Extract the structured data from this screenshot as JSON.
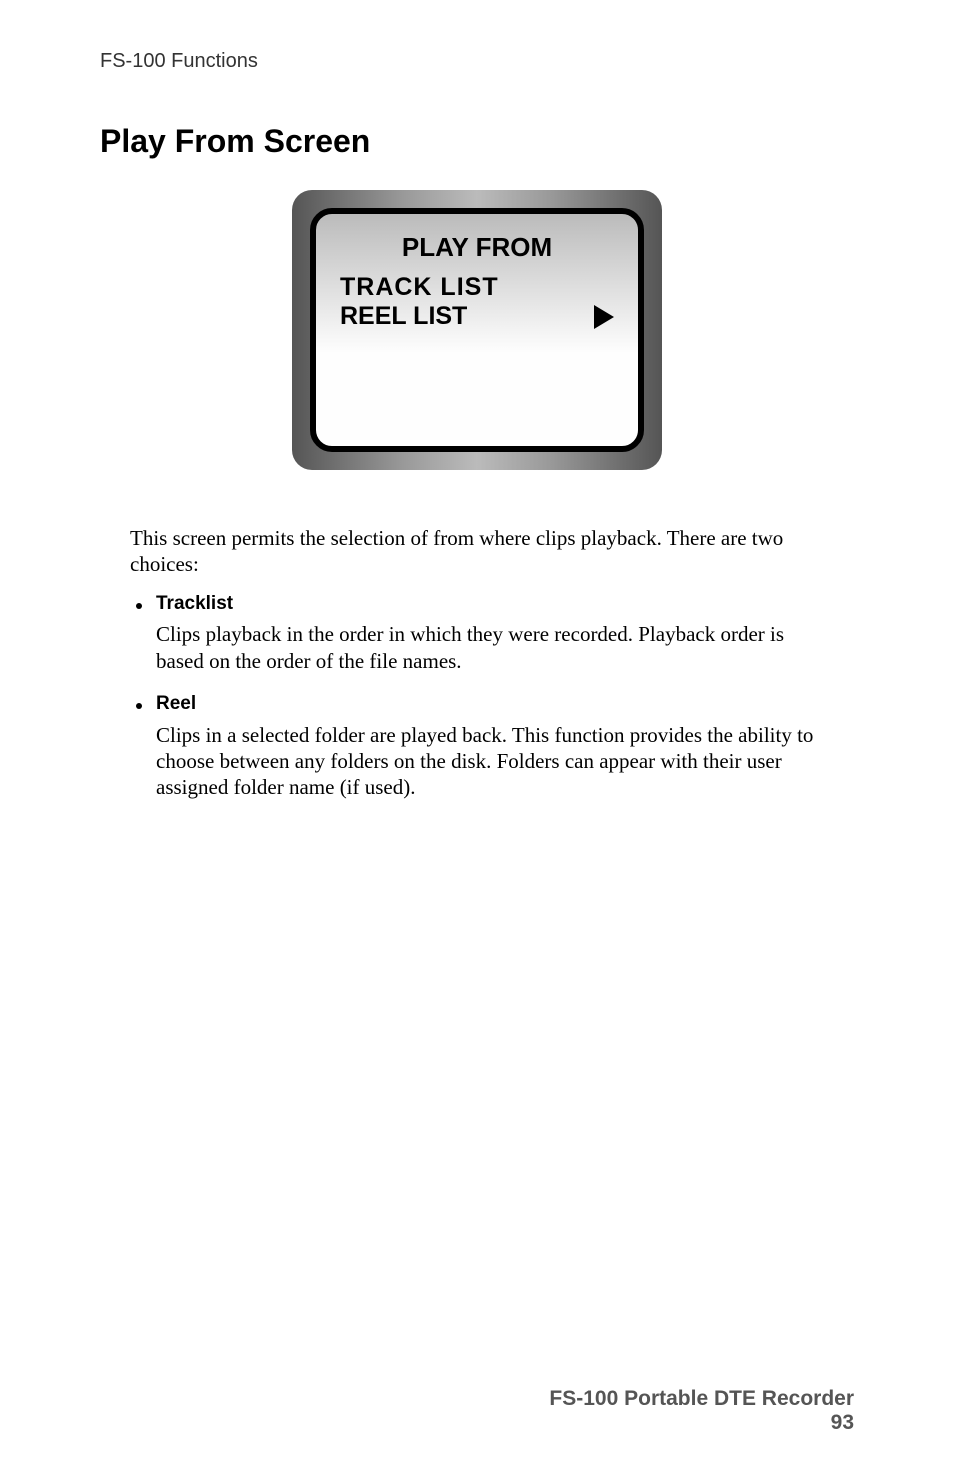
{
  "header": {
    "section": "FS-100 Functions"
  },
  "heading": "Play From Screen",
  "screen": {
    "title": "PLAY FROM",
    "line1": "TRACK LIST",
    "line2": "REEL LIST"
  },
  "intro": "This screen permits the selection of from where clips  playback. There are two choices:",
  "bullets": [
    {
      "label": "Tracklist",
      "desc": "Clips playback in the order in which they were recorded. Playback order is based on the order of the file names."
    },
    {
      "label": "Reel",
      "desc": "Clips in a selected folder are played back. This function provides the ability to choose between any folders on the disk. Folders can appear with their user assigned folder name (if used)."
    }
  ],
  "footer": {
    "title": "FS-100 Portable DTE Recorder",
    "page": "93"
  }
}
